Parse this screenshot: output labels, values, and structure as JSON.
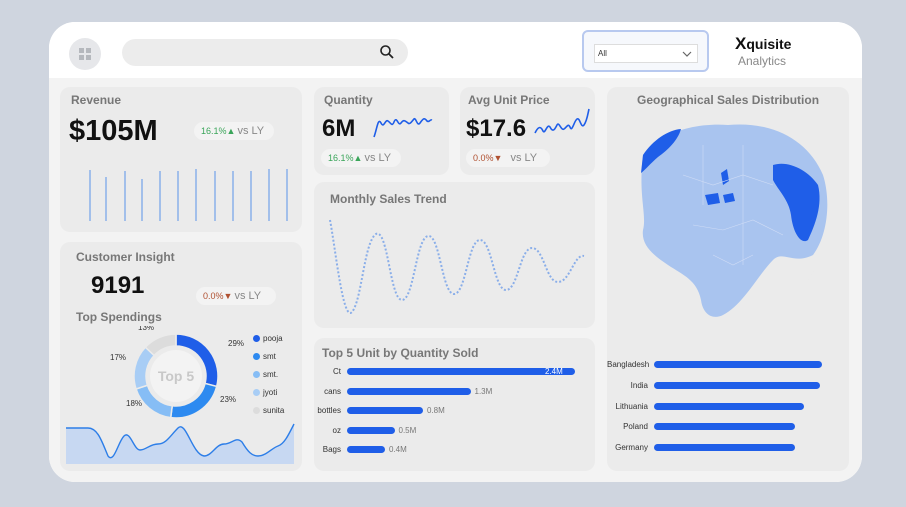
{
  "header": {
    "search_placeholder": "",
    "filter_value": "All",
    "brand_x": "X",
    "brand_rest": "quisite",
    "brand_sub": "Analytics"
  },
  "revenue": {
    "title": "Revenue",
    "value": "$105M",
    "change": "16.1%",
    "dir": "▲",
    "vs": "vs LY"
  },
  "quantity": {
    "title": "Quantity",
    "value": "6M",
    "change": "16.1%",
    "dir": "▲",
    "vs": "vs LY"
  },
  "avg_price": {
    "title": "Avg Unit Price",
    "value": "$17.6",
    "change": "0.0%",
    "dir": "▼",
    "vs": "vs LY"
  },
  "customer": {
    "title": "Customer Insight",
    "value": "9191",
    "change": "0.0%",
    "dir": "▼",
    "vs": "vs LY",
    "spend_title": "Top Spendings"
  },
  "monthly": {
    "title": "Monthly Sales Trend"
  },
  "geo": {
    "title": "Geographical Sales Distribution"
  },
  "top5": {
    "title": "Top 5 Unit by Quantity Sold"
  },
  "chart_data": [
    {
      "type": "pie",
      "title": "Top Spendings",
      "center_label": "Top 5",
      "categories": [
        "pooja",
        "smt",
        "smt.",
        "jyoti",
        "sunita"
      ],
      "values": [
        29,
        23,
        18,
        17,
        13
      ],
      "labels": [
        "29%",
        "23%",
        "18%",
        "17%",
        "13%"
      ],
      "colors": [
        "#1f5ee8",
        "#2d8af0",
        "#86bdf5",
        "#a8cdf5",
        "#dcdcdc"
      ]
    },
    {
      "type": "bar",
      "title": "Top 5 Unit by Quantity Sold",
      "categories": [
        "Ct",
        "cans",
        "bottles",
        "oz",
        "Bags"
      ],
      "values": [
        2.4,
        1.3,
        0.8,
        0.5,
        0.4
      ],
      "labels": [
        "2.4M",
        "1.3M",
        "0.8M",
        "0.5M",
        "0.4M"
      ],
      "color": "#1f5ee8"
    },
    {
      "type": "bar",
      "title": "Geographical Sales Distribution",
      "categories": [
        "Bangladesh",
        "India",
        "Lithuania",
        "Poland",
        "Germany"
      ],
      "values": [
        100,
        99,
        89,
        84,
        84
      ],
      "color": "#1f5ee8"
    }
  ]
}
